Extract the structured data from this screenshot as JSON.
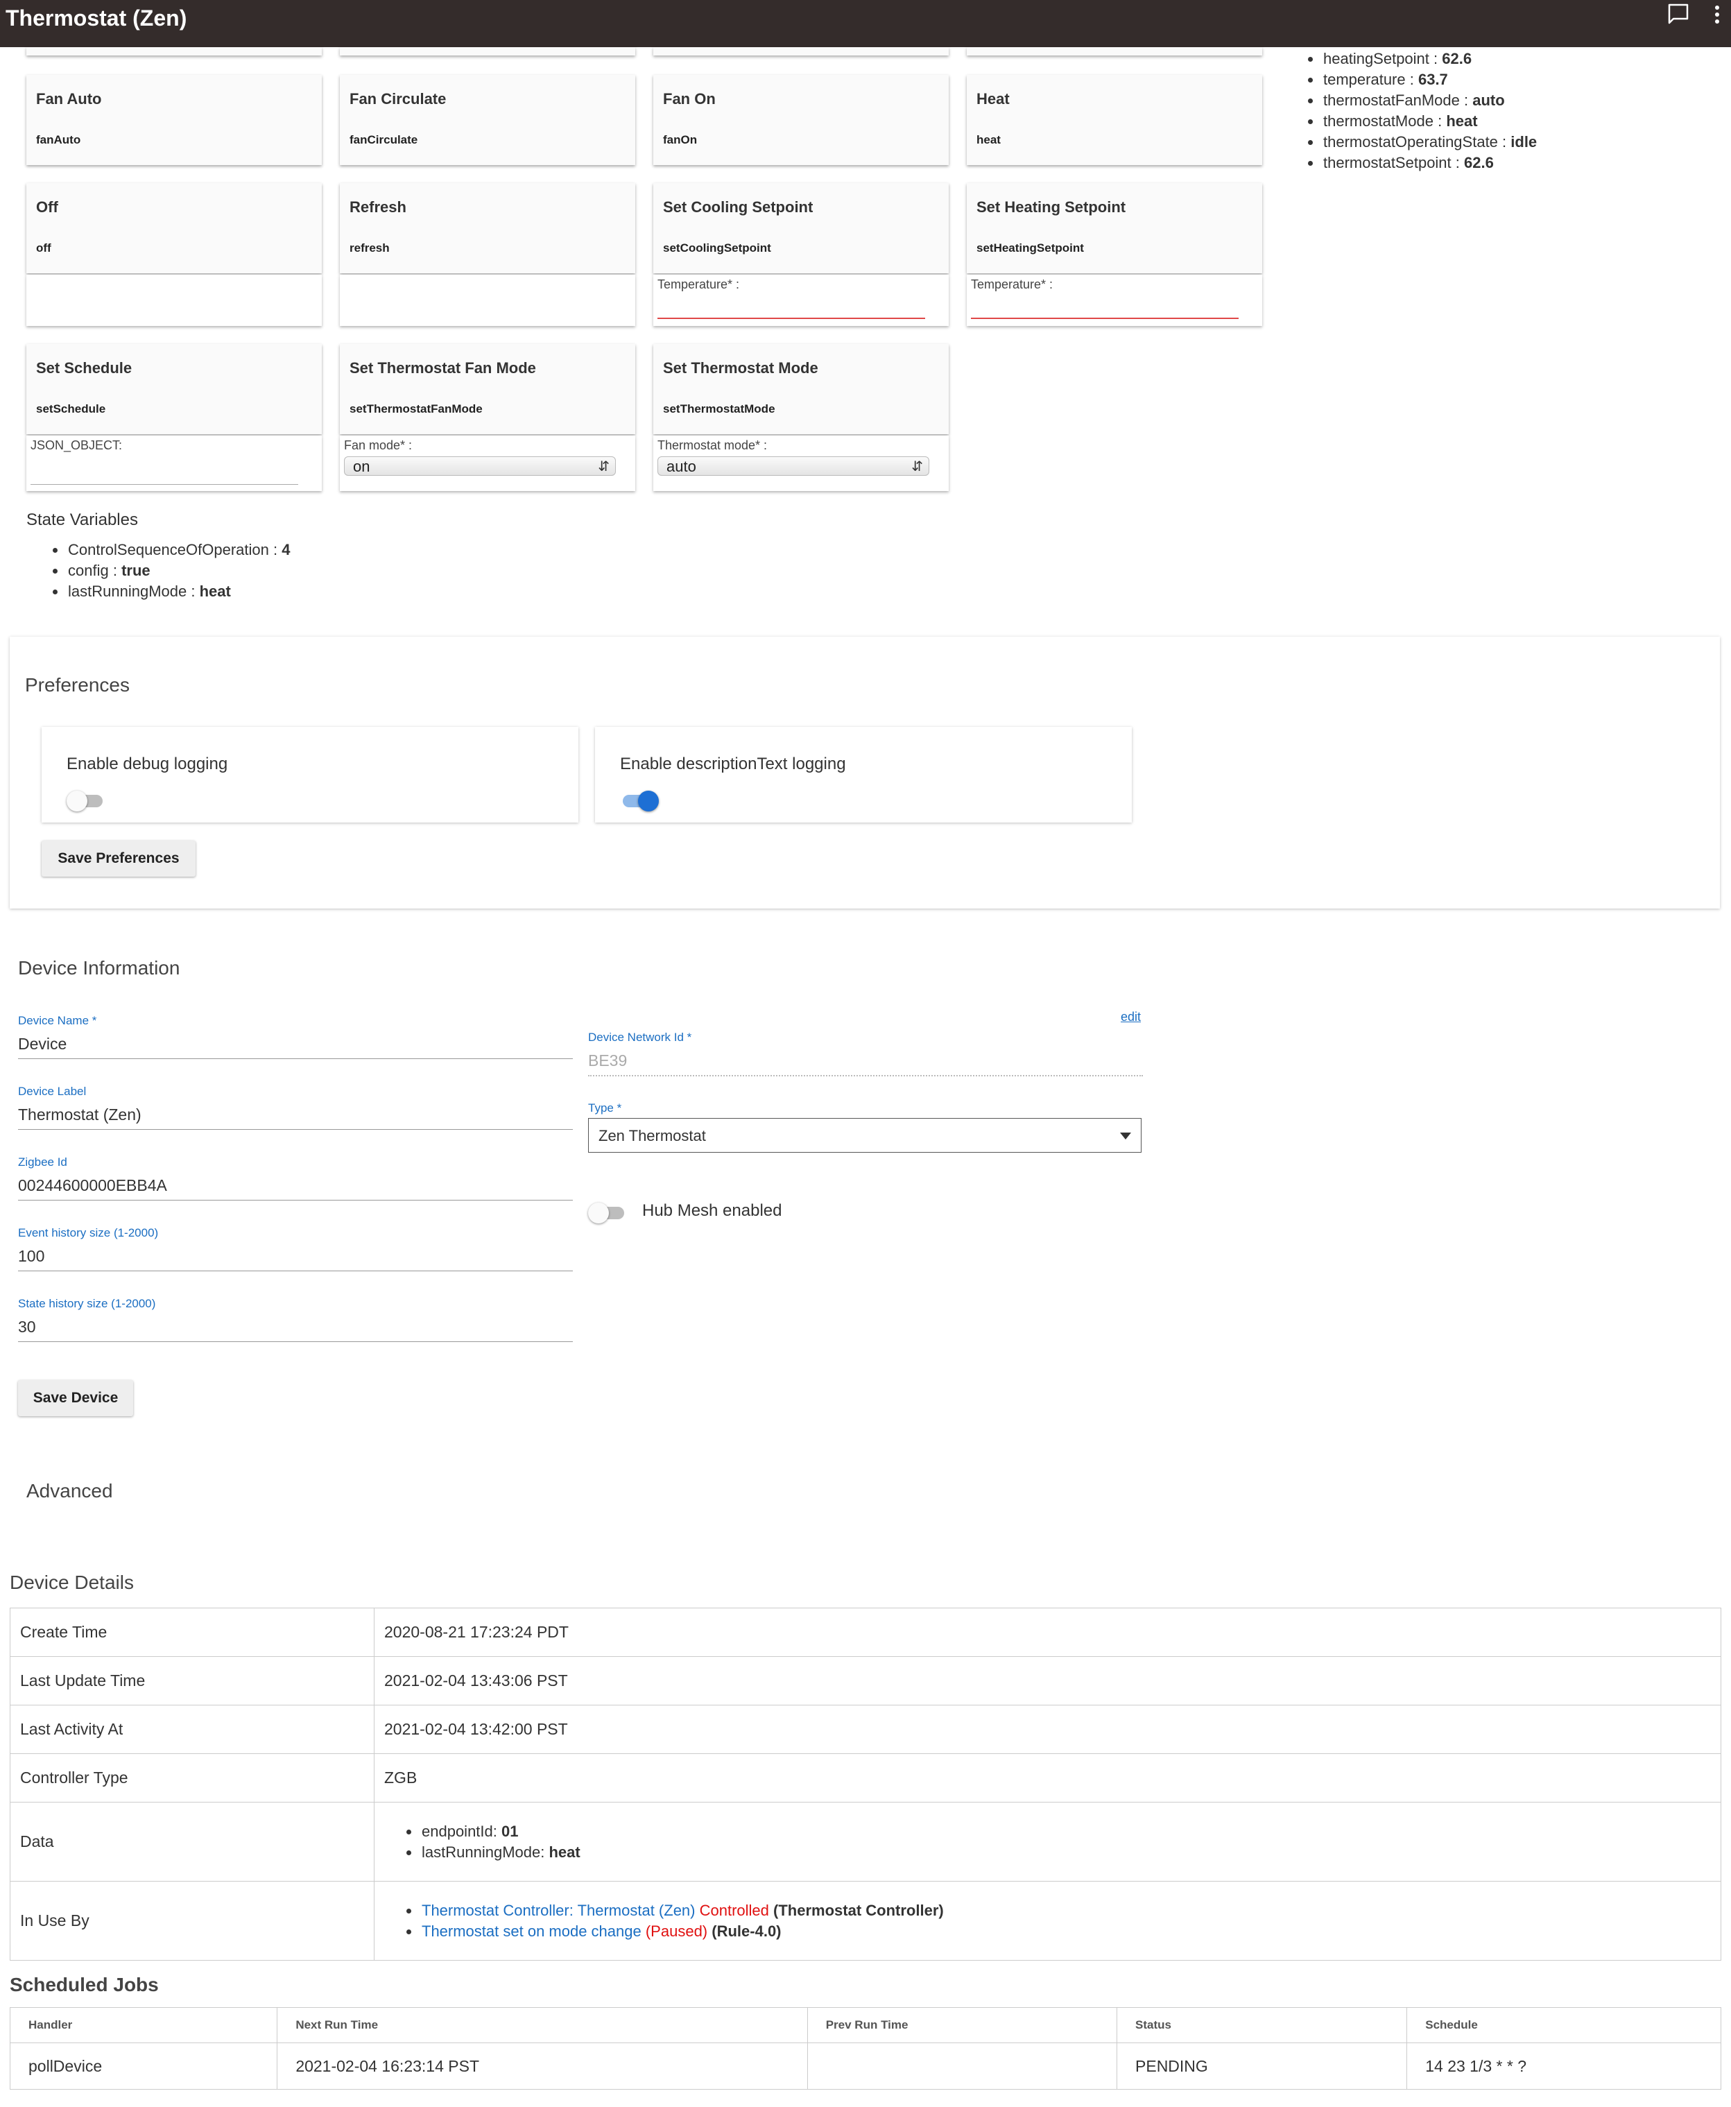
{
  "header": {
    "title": "Thermostat (Zen)"
  },
  "commands": {
    "row1": [
      {
        "name": "Fan Auto",
        "cmd": "fanAuto"
      },
      {
        "name": "Fan Circulate",
        "cmd": "fanCirculate"
      },
      {
        "name": "Fan On",
        "cmd": "fanOn"
      },
      {
        "name": "Heat",
        "cmd": "heat"
      }
    ],
    "row2": [
      {
        "name": "Off",
        "cmd": "off"
      },
      {
        "name": "Refresh",
        "cmd": "refresh"
      },
      {
        "name": "Set Cooling Setpoint",
        "cmd": "setCoolingSetpoint",
        "param_label": "Temperature* :"
      },
      {
        "name": "Set Heating Setpoint",
        "cmd": "setHeatingSetpoint",
        "param_label": "Temperature* :"
      }
    ],
    "row3": [
      {
        "name": "Set Schedule",
        "cmd": "setSchedule",
        "param_label": "JSON_OBJECT:"
      },
      {
        "name": "Set Thermostat Fan Mode",
        "cmd": "setThermostatFanMode",
        "param_label": "Fan mode* :",
        "value": "on"
      },
      {
        "name": "Set Thermostat Mode",
        "cmd": "setThermostatMode",
        "param_label": "Thermostat mode* :",
        "value": "auto"
      }
    ]
  },
  "current_states": [
    {
      "key": "heatingSetpoint",
      "value": "62.6"
    },
    {
      "key": "temperature",
      "value": "63.7"
    },
    {
      "key": "thermostatFanMode",
      "value": "auto"
    },
    {
      "key": "thermostatMode",
      "value": "heat"
    },
    {
      "key": "thermostatOperatingState",
      "value": "idle"
    },
    {
      "key": "thermostatSetpoint",
      "value": "62.6"
    }
  ],
  "state_variables": {
    "title": "State Variables",
    "items": [
      {
        "key": "ControlSequenceOfOperation",
        "value": "4"
      },
      {
        "key": "config",
        "value": "true"
      },
      {
        "key": "lastRunningMode",
        "value": "heat"
      }
    ]
  },
  "preferences": {
    "title": "Preferences",
    "debug_label": "Enable debug logging",
    "debug_on": false,
    "desc_label": "Enable descriptionText logging",
    "desc_on": true,
    "save_label": "Save Preferences"
  },
  "device_info": {
    "title": "Device Information",
    "edit_label": "edit",
    "device_name_label": "Device Name *",
    "device_name": "Device",
    "device_label_label": "Device Label",
    "device_label": "Thermostat (Zen)",
    "zigbee_label": "Zigbee Id",
    "zigbee_id": "00244600000EBB4A",
    "event_history_label": "Event history size (1-2000)",
    "event_history": "100",
    "state_history_label": "State history size (1-2000)",
    "state_history": "30",
    "network_id_label": "Device Network Id *",
    "network_id": "BE39",
    "type_label": "Type *",
    "type_value": "Zen Thermostat",
    "hub_mesh_label": "Hub Mesh enabled",
    "hub_mesh_on": false,
    "save_label": "Save Device"
  },
  "advanced": {
    "title": "Advanced"
  },
  "device_details": {
    "title": "Device Details",
    "create_time_label": "Create Time",
    "create_time": "2020-08-21 17:23:24 PDT",
    "last_update_label": "Last Update Time",
    "last_update": "2021-02-04 13:43:06 PST",
    "last_activity_label": "Last Activity At",
    "last_activity": "2021-02-04 13:42:00 PST",
    "controller_type_label": "Controller Type",
    "controller_type": "ZGB",
    "data_label": "Data",
    "data_items": [
      {
        "key": "endpointId: ",
        "value": "01"
      },
      {
        "key": "lastRunningMode: ",
        "value": "heat"
      }
    ],
    "in_use_label": "In Use By",
    "in_use": [
      {
        "link": "Thermostat Controller: Thermostat (Zen)",
        "status": "Controlled",
        "type": "(Thermostat Controller)"
      },
      {
        "link": "Thermostat set on mode change",
        "status": "(Paused)",
        "type": "(Rule-4.0)"
      }
    ]
  },
  "scheduled_jobs": {
    "title": "Scheduled Jobs",
    "headers": [
      "Handler",
      "Next Run Time",
      "Prev Run Time",
      "Status",
      "Schedule"
    ],
    "rows": [
      [
        "pollDevice",
        "2021-02-04 16:23:14 PST",
        "",
        "PENDING",
        "14 23 1/3 * * ?"
      ]
    ]
  }
}
